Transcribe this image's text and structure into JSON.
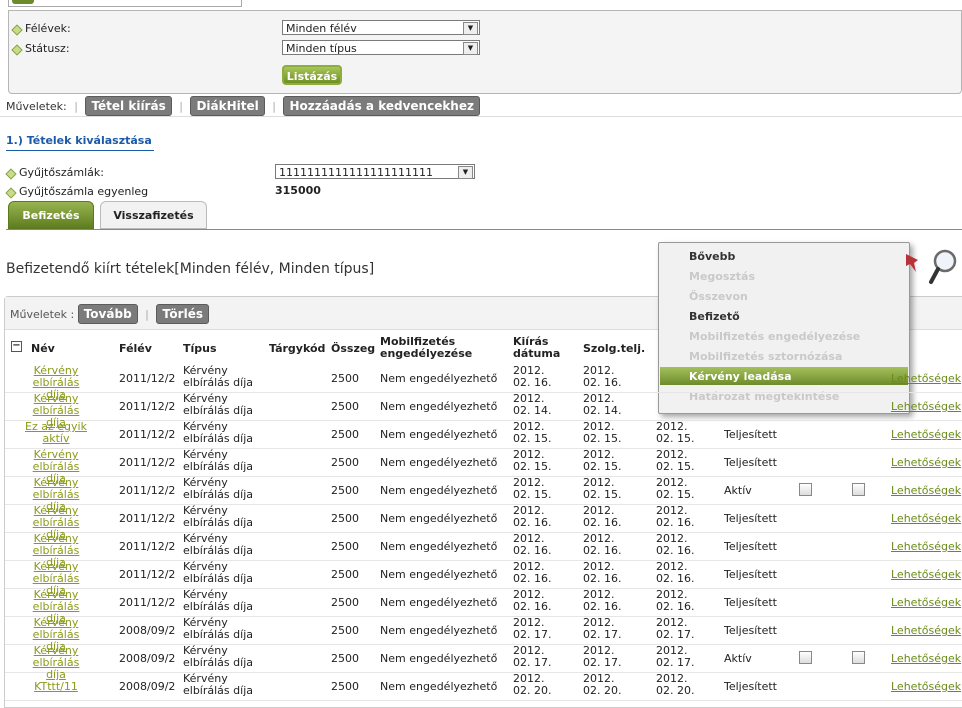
{
  "filters": {
    "felevek_label": "Félévek:",
    "felevek_value": "Minden félév",
    "statusz_label": "Státusz:",
    "statusz_value": "Minden típus",
    "list_button": "Listázás"
  },
  "actions": {
    "label": "Műveletek:",
    "buttons": [
      "Tétel kiírás",
      "DiákHitel",
      "Hozzáadás a kedvencekhez"
    ]
  },
  "section": {
    "title": "1.) Tételek kiválasztása",
    "gyujto_label": "Gyűjtőszámlák:",
    "gyujto_value": "1111111111111111111111",
    "egyenleg_label": "Gyűjtőszámla egyenleg",
    "egyenleg_value": "315000"
  },
  "tabs": [
    "Befizetés",
    "Visszafizetés"
  ],
  "list_title": "Befizetendő kiírt tételek[Minden félév, Minden típus]",
  "grid": {
    "actions_label": "Műveletek :",
    "actions": [
      "Tovább",
      "Törlés"
    ],
    "headers": {
      "nev": "Név",
      "felev": "Félév",
      "tipus": "Típus",
      "targykod": "Tárgykód",
      "osszeg": "Összeg",
      "mobil": "Mobilfizetés engedélyezése",
      "kiiras": "Kiírás dátuma",
      "szolg": "Szolg.telj."
    },
    "rows": [
      {
        "nev": "Kérvény elbírálás díja",
        "felev": "2011/12/2",
        "tipus": "Kérvény elbírálás díja",
        "osszeg": "2500",
        "mobil": "Nem engedélyezhető",
        "kiiras": "2012. 02. 16.",
        "szolg": "2012. 02. 16.",
        "hatarido": "",
        "allapot": "",
        "c1": false,
        "c2": false,
        "opt": "Lehetőségek"
      },
      {
        "nev": "Kérvény elbírálás díja",
        "felev": "2011/12/2",
        "tipus": "Kérvény elbírálás díja",
        "osszeg": "2500",
        "mobil": "Nem engedélyezhető",
        "kiiras": "2012. 02. 14.",
        "szolg": "2012. 02. 14.",
        "hatarido": "",
        "allapot": "",
        "c1": false,
        "c2": false,
        "opt": "Lehetőségek"
      },
      {
        "nev": "Ez az egyik aktív",
        "felev": "2011/12/2",
        "tipus": "Kérvény elbírálás díja",
        "osszeg": "2500",
        "mobil": "Nem engedélyezhető",
        "kiiras": "2012. 02. 15.",
        "szolg": "2012. 02. 15.",
        "hatarido": "2012. 02. 15.",
        "allapot": "Teljesített",
        "c1": false,
        "c2": false,
        "opt": "Lehetőségek"
      },
      {
        "nev": "Kérvény elbírálás díja",
        "felev": "2011/12/2",
        "tipus": "Kérvény elbírálás díja",
        "osszeg": "2500",
        "mobil": "Nem engedélyezhető",
        "kiiras": "2012. 02. 15.",
        "szolg": "2012. 02. 15.",
        "hatarido": "2012. 02. 15.",
        "allapot": "Teljesített",
        "c1": false,
        "c2": false,
        "opt": "Lehetőségek"
      },
      {
        "nev": "Kérvény elbírálás díja",
        "felev": "2011/12/2",
        "tipus": "Kérvény elbírálás díja",
        "osszeg": "2500",
        "mobil": "Nem engedélyezhető",
        "kiiras": "2012. 02. 15.",
        "szolg": "2012. 02. 15.",
        "hatarido": "2012. 02. 15.",
        "allapot": "Aktív",
        "c1": true,
        "c2": true,
        "opt": "Lehetőségek"
      },
      {
        "nev": "Kérvény elbírálás díja",
        "felev": "2011/12/2",
        "tipus": "Kérvény elbírálás díja",
        "osszeg": "2500",
        "mobil": "Nem engedélyezhető",
        "kiiras": "2012. 02. 16.",
        "szolg": "2012. 02. 16.",
        "hatarido": "2012. 02. 16.",
        "allapot": "Teljesített",
        "c1": false,
        "c2": false,
        "opt": "Lehetőségek"
      },
      {
        "nev": "Kérvény elbírálás díja",
        "felev": "2011/12/2",
        "tipus": "Kérvény elbírálás díja",
        "osszeg": "2500",
        "mobil": "Nem engedélyezhető",
        "kiiras": "2012. 02. 16.",
        "szolg": "2012. 02. 16.",
        "hatarido": "2012. 02. 16.",
        "allapot": "Teljesített",
        "c1": false,
        "c2": false,
        "opt": "Lehetőségek"
      },
      {
        "nev": "Kérvény elbírálás díja",
        "felev": "2011/12/2",
        "tipus": "Kérvény elbírálás díja",
        "osszeg": "2500",
        "mobil": "Nem engedélyezhető",
        "kiiras": "2012. 02. 16.",
        "szolg": "2012. 02. 16.",
        "hatarido": "2012. 02. 16.",
        "allapot": "Teljesített",
        "c1": false,
        "c2": false,
        "opt": "Lehetőségek"
      },
      {
        "nev": "Kérvény elbírálás díja",
        "felev": "2011/12/2",
        "tipus": "Kérvény elbírálás díja",
        "osszeg": "2500",
        "mobil": "Nem engedélyezhető",
        "kiiras": "2012. 02. 16.",
        "szolg": "2012. 02. 16.",
        "hatarido": "2012. 02. 16.",
        "allapot": "Teljesített",
        "c1": false,
        "c2": false,
        "opt": "Lehetőségek"
      },
      {
        "nev": "Kérvény elbírálás díja",
        "felev": "2008/09/2",
        "tipus": "Kérvény elbírálás díja",
        "osszeg": "2500",
        "mobil": "Nem engedélyezhető",
        "kiiras": "2012. 02. 17.",
        "szolg": "2012. 02. 17.",
        "hatarido": "2012. 02. 17.",
        "allapot": "Teljesített",
        "c1": false,
        "c2": false,
        "opt": "Lehetőségek"
      },
      {
        "nev": "Kérvény elbírálás díja",
        "felev": "2008/09/2",
        "tipus": "Kérvény elbírálás díja",
        "osszeg": "2500",
        "mobil": "Nem engedélyezhető",
        "kiiras": "2012. 02. 17.",
        "szolg": "2012. 02. 17.",
        "hatarido": "2012. 02. 17.",
        "allapot": "Aktív",
        "c1": true,
        "c2": true,
        "opt": "Lehetőségek"
      },
      {
        "nev": "KTttt/11",
        "felev": "2008/09/2",
        "tipus": "Kérvény elbírálás díja",
        "osszeg": "2500",
        "mobil": "Nem engedélyezhető",
        "kiiras": "2012. 02. 20.",
        "szolg": "2012. 02. 20.",
        "hatarido": "2012. 02. 20.",
        "allapot": "Teljesített",
        "c1": false,
        "c2": false,
        "opt": "Lehetőségek"
      }
    ]
  },
  "context_menu": {
    "items": [
      {
        "label": "Bővebb",
        "enabled": true,
        "selected": false
      },
      {
        "label": "Megosztás",
        "enabled": false,
        "selected": false
      },
      {
        "label": "Összevon",
        "enabled": false,
        "selected": false
      },
      {
        "label": "Befizető",
        "enabled": true,
        "selected": false
      },
      {
        "label": "Mobilfizetés engedélyezése",
        "enabled": false,
        "selected": false
      },
      {
        "label": "Mobilfizetés sztornózása",
        "enabled": false,
        "selected": false
      },
      {
        "label": "Kérvény leadása",
        "enabled": true,
        "selected": true
      },
      {
        "label": "Határozat megtekintése",
        "enabled": false,
        "selected": false
      }
    ]
  },
  "colors": {
    "accent": "#6f8e25",
    "link": "#8a9a1a",
    "menu_selected": "#7b9a34"
  }
}
